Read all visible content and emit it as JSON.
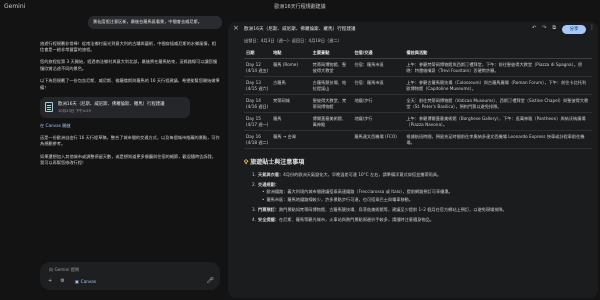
{
  "app": {
    "brand": "Gemini",
    "title": "歐洲16天行程規劃建議"
  },
  "chat": {
    "user_message": "景仙度假注意区新，最後台羅馬區看景，中間會去威尼斯。",
    "paragraphs": [
      "旅遊行程規劃非常棒！從南法鄉村風光到意大利的古蹟與藝術，中間穿插威尼斯的水鄉風情，相信會是一趟非常豐富的旅程。",
      "您的旅程從第 3 天開始，經過南法鄉村與意大利北部，最後將在羅馬結束，這條路線可以讓您慢慢欣賞沿途不同的景色。",
      "以下為您規劃了一份包含尼斯、威尼斯、佛羅倫斯與羅馬的 16 天行程建議，希望能幫您開始做準備！"
    ],
    "doc_chip": {
      "title": "歐洲16天（尼斯、威尼斯、佛羅倫斯、羅馬）行程建議",
      "date": "10月23日 下午4:29"
    },
    "canvas_link": "在 Canvas 開啟",
    "paragraphs2": [
      "這是一份歐洲自由行 16 天行程草稿，整合了城市間的交通方式，以及每個城市推薦的景點，可作為規劃參考。",
      "如果還想加入其他城市或調整停留天數，或是想知道更多餐廳與住宿的細節，歡迎隨時告訴我，我可以再幫您修改行程！"
    ],
    "composer_placeholder": "向 Gemini 提問"
  },
  "panel": {
    "title": "歐洲16天（尼斯、威尼斯、佛羅倫斯、羅馬）行程建議",
    "share_label": "分享",
    "subheading": "出發日：4月3日（週一）· 返回日：4月18日（週二）",
    "columns": [
      "日期",
      "地點",
      "主要景點",
      "住宿/交通",
      "備註與活動"
    ],
    "rows": [
      {
        "day": "Day 12\n(4/14 週五)",
        "city": "羅馬 (Rome)",
        "spots": "梵蒂岡博物館、聖彼得大教堂",
        "transport": "住宿：羅馬市區",
        "notes": "上午：參觀梵蒂岡博物館與西斯汀禮拜堂，下午：前往聖彼得大教堂（Piazza di Spagna）。傍晚：特雷維噴泉（Trevi Fountain）丟硬幣許願。"
      },
      {
        "day": "Day 13\n(4/15 週六)",
        "city": "古羅馬",
        "spots": "古羅馬競技場、帕拉提諾山",
        "transport": "住宿：羅馬市區",
        "notes": "上午：參觀古羅馬競技場（Colosseum）與古羅馬廣場（Roman Forum），下午：前往卡比托利歐博物館（Capitoline Museums）。"
      },
      {
        "day": "Day 14\n(4/16 週日)",
        "city": "梵蒂岡城",
        "spots": "聖彼得大教堂、梵蒂岡博物館",
        "transport": "地鐵/步行",
        "notes": "全天：前往梵蒂岡博物館（Vatican Museums）、西斯汀禮拜堂（Sistine Chapel）與聖彼得大教堂（St. Peter's Basilica），預約門票以避免排隊。"
      },
      {
        "day": "Day 15\n(4/17 週一)",
        "city": "羅馬",
        "spots": "博爾蓋塞美術館、萬神殿",
        "transport": "地鐵/步行",
        "notes": "上午：參觀博爾蓋塞美術館（Borghese Gallery），下午：逛萬神殿（Pantheon）與納沃納廣場（Piazza Navona）。"
      },
      {
        "day": "Day 16\n(4/18 週二)",
        "city": "羅馬 → 台灣",
        "spots": "",
        "transport": "羅馬達文西機場 (FCO)",
        "notes": "根據航班時間，預留充足時間前往李奧納多達文西機場 Leonardo Express 快車或計程車前往機場。"
      }
    ],
    "notes_heading": "旅遊貼士與注意事項",
    "notes": [
      {
        "label": "天氣與衣著：",
        "text": "4月份的歐洲天氣變化大，早晚溫差可達 10°C 左右，請準備洋蔥式穿搭並攜帶雨具。"
      },
      {
        "label": "交通規劃：",
        "text": "",
        "sub": [
          "歐洲鐵路：義大利境內城市間建議搭乘高速鐵路（Frecciarossa 或 Italo），提前網路預訂可享優惠。",
          "羅馬市區：羅馬地鐵路線較少，許多景點步行可達，也可搭乘巴士與電車移動。"
        ]
      },
      {
        "label": "門票預訂：",
        "text": "熱門景點如梵蒂岡博物館、古羅馬競技場、烏菲茲美術館等，建議至少提前 1–2 個月在官方網站上預訂，以避免現場排隊。"
      },
      {
        "label": "安全提醒：",
        "text": "在尼斯、羅馬等觀光城市，火車站與熱門景點周邊扒手較多，請隨時注意隨身物品。"
      }
    ]
  }
}
